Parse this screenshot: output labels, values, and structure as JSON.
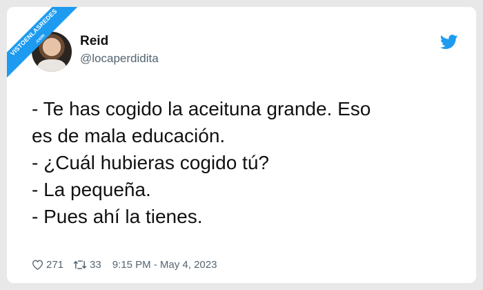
{
  "watermark": {
    "line1": "VISTOENLASREDES",
    "line2": ".com"
  },
  "user": {
    "name": "Reid",
    "handle": "@locaperdidita"
  },
  "tweet": {
    "lines": [
      "- Te has cogido la aceituna grande. Eso",
      "es de mala educación.",
      "- ¿Cuál hubieras cogido tú?",
      "- La pequeña.",
      "- Pues ahí la tienes."
    ]
  },
  "stats": {
    "likes": "271",
    "retweets": "33",
    "timestamp": "9:15 PM - May 4, 2023"
  },
  "icons": {
    "platform": "twitter-bird-icon",
    "like": "heart-icon",
    "retweet": "retweet-icon"
  },
  "colors": {
    "accent": "#1d9bf0",
    "text": "#111111",
    "muted": "#536471"
  }
}
